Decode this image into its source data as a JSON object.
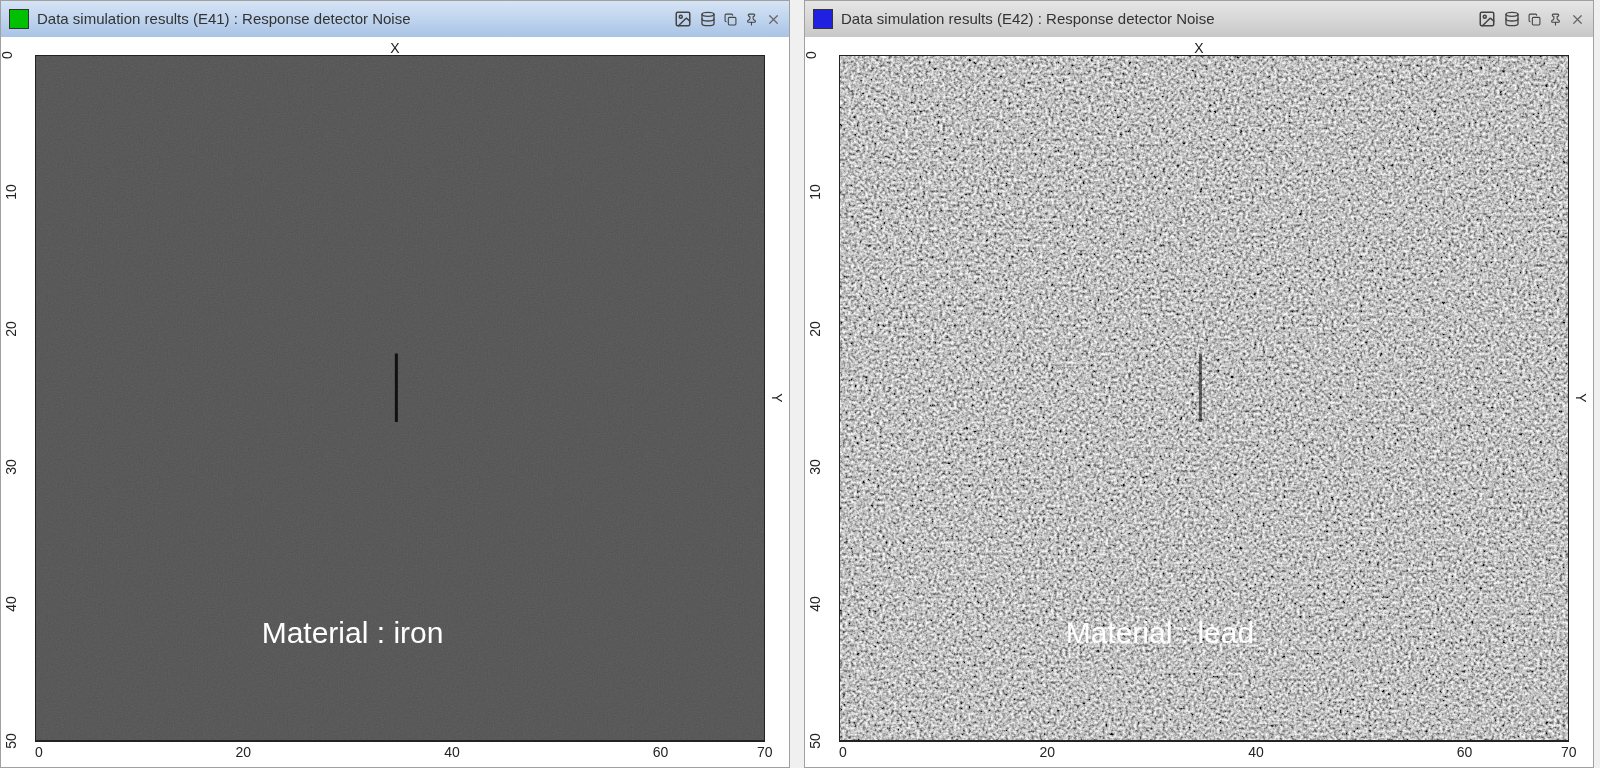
{
  "panels": [
    {
      "title": "Data simulation results (E41) : Response detector Noise",
      "color": "#00c000",
      "active": true,
      "x_label": "X",
      "y_label": "Y",
      "kind": "dark",
      "caption": "Material : iron",
      "x_ticks": [
        "0",
        "20",
        "40",
        "60",
        "70"
      ],
      "y_ticks": [
        "0",
        "10",
        "20",
        "30",
        "40",
        "50"
      ]
    },
    {
      "title": "Data simulation results (E42) : Response detector Noise",
      "color": "#2020e0",
      "active": false,
      "x_label": "X",
      "y_label": "Y",
      "kind": "light",
      "caption": "Material : lead",
      "x_ticks": [
        "0",
        "20",
        "40",
        "60",
        "70"
      ],
      "y_ticks": [
        "0",
        "10",
        "20",
        "30",
        "40",
        "50"
      ]
    }
  ]
}
